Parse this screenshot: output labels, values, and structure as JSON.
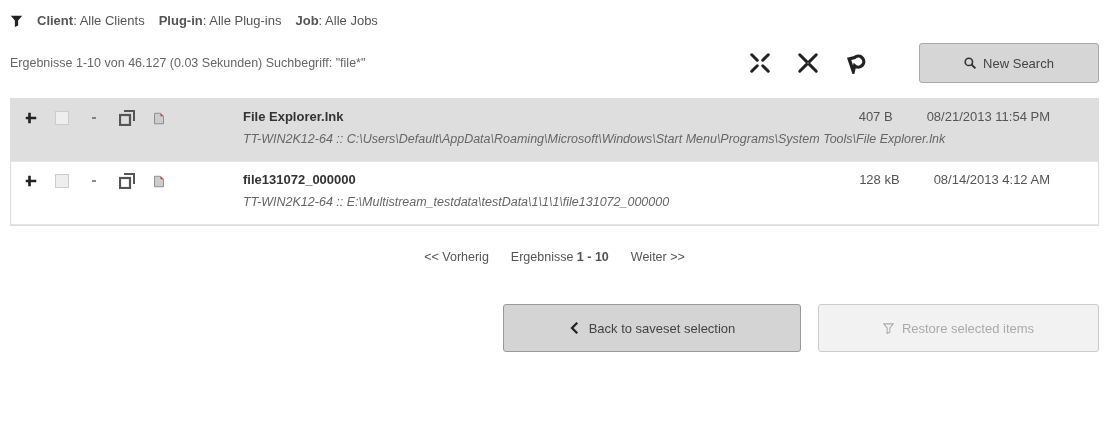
{
  "filters": [
    "**Client**: Alle Clients",
    "**Plug-in**: Alle Plug-ins",
    "**Job**: Alle Jobs"
  ],
  "summary": "Ergebnisse 1-10 von 46.127 (0.03 Sekunden) Suchbegriff: \"file*\"",
  "new_search": "New Search",
  "results": [
    {
      "name": "File Explorer.lnk",
      "size": "407 B",
      "date": "08/21/2013 11:54 PM",
      "path": "TT-WIN2K12-64 :: C:\\Users\\Default\\AppData\\Roaming\\Microsoft\\Windows\\Start Menu\\Programs\\System Tools\\File Explorer.lnk",
      "selected": true,
      "checked": false
    },
    {
      "name": "file131072_000000",
      "size": "128 kB",
      "date": "08/14/2013 4:12 AM",
      "path": "TT-WIN2K12-64 :: E:\\Multistream_testdata\\testData\\1\\1\\1\\file131072_000000",
      "selected": false,
      "checked": false
    }
  ],
  "pagination": {
    "previous": "<< Vorherig",
    "range": "Ergebnisse **1 - 10**",
    "next": "Weiter >>"
  },
  "buttons": [
    {
      "kind": "back",
      "label": "Back to saveset selection",
      "disabled": false
    },
    {
      "kind": "restore",
      "label": "Restore selected items",
      "disabled": true
    }
  ]
}
